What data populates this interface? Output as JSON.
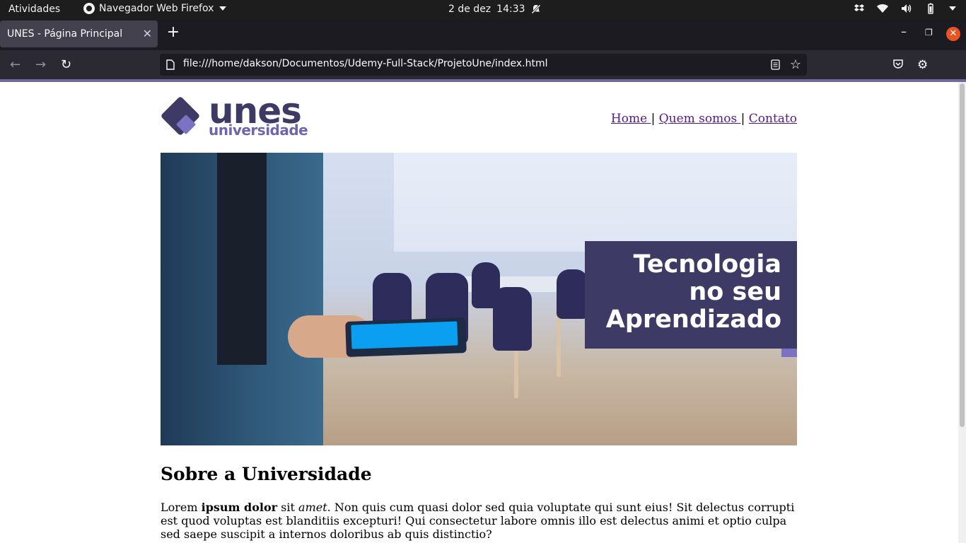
{
  "system_bar": {
    "activities": "Atividades",
    "app_name": "Navegador Web Firefox",
    "date": "2 de dez",
    "time": "14:33"
  },
  "browser": {
    "tab_title": "UNES - Página Principal",
    "url": "file:///home/dakson/Documentos/Udemy-Full-Stack/ProjetoUne/index.html"
  },
  "site": {
    "logo": {
      "word1": "unes",
      "word2": "universidade"
    },
    "nav": [
      {
        "label": "Home "
      },
      {
        "label": "Quem somos "
      },
      {
        "label": "Contato"
      }
    ],
    "nav_separator": "|",
    "banner": {
      "line1": "Tecnologia",
      "line2": "no seu",
      "line3": "Aprendizado"
    },
    "section_title": "Sobre a Universidade",
    "paragraph": {
      "w1": "Lorem ",
      "w2": "ipsum dolor",
      "w3": " sit ",
      "w4": "amet",
      "w5": ". Non quis cum quasi dolor sed quia voluptate qui sunt eius! Sit delectus corrupti est quod voluptas est blanditiis excepturi! Qui consectetur labore omnis illo est delectus animi et optio culpa sed saepe suscipit a internos doloribus ab quis distinctio?"
    }
  },
  "colors": {
    "brand_dark": "#3e3a66",
    "brand_light": "#6e66ad",
    "link": "#551a8b"
  }
}
